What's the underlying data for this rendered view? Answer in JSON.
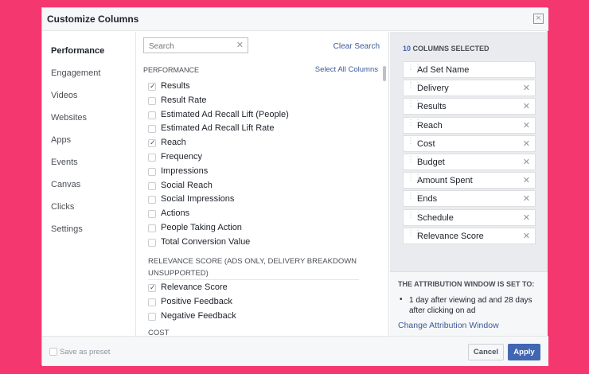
{
  "dialog": {
    "title": "Customize Columns"
  },
  "nav": [
    "Performance",
    "Engagement",
    "Videos",
    "Websites",
    "Apps",
    "Events",
    "Canvas",
    "Clicks",
    "Settings"
  ],
  "search": {
    "placeholder": "Search",
    "clear_label": "Clear Search"
  },
  "list": {
    "section_title": "PERFORMANCE",
    "select_all": "Select All Columns",
    "performance_items": [
      {
        "label": "Results",
        "checked": true
      },
      {
        "label": "Result Rate",
        "checked": false
      },
      {
        "label": "Estimated Ad Recall Lift (People)",
        "checked": false
      },
      {
        "label": "Estimated Ad Recall Lift Rate",
        "checked": false
      },
      {
        "label": "Reach",
        "checked": true
      },
      {
        "label": "Frequency",
        "checked": false
      },
      {
        "label": "Impressions",
        "checked": false
      },
      {
        "label": "Social Reach",
        "checked": false
      },
      {
        "label": "Social Impressions",
        "checked": false
      },
      {
        "label": "Actions",
        "checked": false
      },
      {
        "label": "People Taking Action",
        "checked": false
      },
      {
        "label": "Total Conversion Value",
        "checked": false
      }
    ],
    "relevance_header": "RELEVANCE SCORE (ADS ONLY, DELIVERY BREAKDOWN UNSUPPORTED)",
    "relevance_items": [
      {
        "label": "Relevance Score",
        "checked": true
      },
      {
        "label": "Positive Feedback",
        "checked": false
      },
      {
        "label": "Negative Feedback",
        "checked": false
      }
    ],
    "cost_header": "COST"
  },
  "selected": {
    "count": "10",
    "label": "COLUMNS SELECTED",
    "columns": [
      {
        "label": "Ad Set Name",
        "removable": false
      },
      {
        "label": "Delivery",
        "removable": true
      },
      {
        "label": "Results",
        "removable": true
      },
      {
        "label": "Reach",
        "removable": true
      },
      {
        "label": "Cost",
        "removable": true
      },
      {
        "label": "Budget",
        "removable": true
      },
      {
        "label": "Amount Spent",
        "removable": true
      },
      {
        "label": "Ends",
        "removable": true
      },
      {
        "label": "Schedule",
        "removable": true
      },
      {
        "label": "Relevance Score",
        "removable": true
      }
    ]
  },
  "attribution": {
    "title": "THE ATTRIBUTION WINDOW IS SET TO:",
    "text": "1 day after viewing ad and 28 days after clicking on ad",
    "link": "Change Attribution Window"
  },
  "footer": {
    "preset_label": "Save as preset",
    "cancel": "Cancel",
    "apply": "Apply"
  },
  "colors": {
    "background": "#f4386f",
    "accent": "#4267b2",
    "link": "#3b5998"
  },
  "icons": {
    "close": "close-icon",
    "remove": "remove-icon",
    "drag": "drag-handle-icon",
    "check": "checkmark-icon"
  }
}
